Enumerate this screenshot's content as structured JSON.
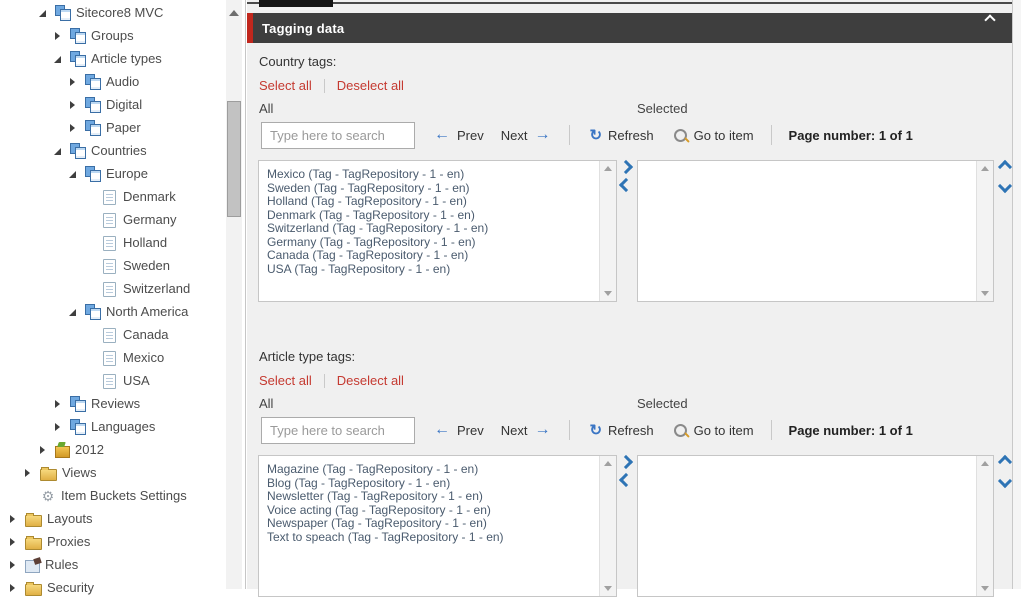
{
  "tree": {
    "items": [
      {
        "label": "Sitecore8 MVC",
        "depth": 2,
        "state": "expanded",
        "icon": "sitecore-node-icon"
      },
      {
        "label": "Groups",
        "depth": 3,
        "state": "collapsed",
        "icon": "sitecore-node-icon"
      },
      {
        "label": "Article types",
        "depth": 3,
        "state": "expanded",
        "icon": "sitecore-node-icon"
      },
      {
        "label": "Audio",
        "depth": 4,
        "state": "collapsed",
        "icon": "sitecore-node-icon"
      },
      {
        "label": "Digital",
        "depth": 4,
        "state": "collapsed",
        "icon": "sitecore-node-icon"
      },
      {
        "label": "Paper",
        "depth": 4,
        "state": "collapsed",
        "icon": "sitecore-node-icon"
      },
      {
        "label": "Countries",
        "depth": 3,
        "state": "expanded",
        "icon": "sitecore-node-icon"
      },
      {
        "label": "Europe",
        "depth": 4,
        "state": "expanded",
        "icon": "sitecore-node-icon"
      },
      {
        "label": "Denmark",
        "depth": 5,
        "state": "none",
        "icon": "document-icon"
      },
      {
        "label": "Germany",
        "depth": 5,
        "state": "none",
        "icon": "document-icon"
      },
      {
        "label": "Holland",
        "depth": 5,
        "state": "none",
        "icon": "document-icon"
      },
      {
        "label": "Sweden",
        "depth": 5,
        "state": "none",
        "icon": "document-icon"
      },
      {
        "label": "Switzerland",
        "depth": 5,
        "state": "none",
        "icon": "document-icon"
      },
      {
        "label": "North America",
        "depth": 4,
        "state": "expanded",
        "icon": "sitecore-node-icon"
      },
      {
        "label": "Canada",
        "depth": 5,
        "state": "none",
        "icon": "document-icon"
      },
      {
        "label": "Mexico",
        "depth": 5,
        "state": "none",
        "icon": "document-icon"
      },
      {
        "label": "USA",
        "depth": 5,
        "state": "none",
        "icon": "document-icon"
      },
      {
        "label": "Reviews",
        "depth": 3,
        "state": "collapsed",
        "icon": "sitecore-node-icon"
      },
      {
        "label": "Languages",
        "depth": 3,
        "state": "collapsed",
        "icon": "sitecore-node-icon"
      },
      {
        "label": "2012",
        "depth": 2,
        "state": "collapsed",
        "icon": "archive-icon"
      },
      {
        "label": "Views",
        "depth": 1,
        "state": "collapsed",
        "icon": "folder-icon"
      },
      {
        "label": "Item Buckets Settings",
        "depth": 1,
        "state": "none",
        "icon": "gear-icon"
      },
      {
        "label": "Layouts",
        "depth": 0,
        "state": "collapsed",
        "icon": "folder-icon"
      },
      {
        "label": "Proxies",
        "depth": 0,
        "state": "collapsed",
        "icon": "folder-icon"
      },
      {
        "label": "Rules",
        "depth": 0,
        "state": "collapsed",
        "icon": "rules-icon"
      },
      {
        "label": "Security",
        "depth": 0,
        "state": "collapsed",
        "icon": "folder-icon"
      }
    ]
  },
  "panel": {
    "title": "Tagging data",
    "collapse_icon": "chevron-up-icon",
    "sections": [
      {
        "id": "country-tags",
        "label": "Country tags:",
        "select_all_label": "Select all",
        "deselect_all_label": "Deselect all",
        "all_label": "All",
        "selected_label": "Selected",
        "search_placeholder": "Type here to search",
        "prev_label": "Prev",
        "next_label": "Next",
        "refresh_label": "Refresh",
        "goto_label": "Go to item",
        "page_label": "Page number: 1 of 1",
        "items": [
          "Mexico (Tag - TagRepository - 1 - en)",
          "Sweden (Tag - TagRepository - 1 - en)",
          "Holland (Tag - TagRepository - 1 - en)",
          "Denmark (Tag - TagRepository - 1 - en)",
          "Switzerland (Tag - TagRepository - 1 - en)",
          "Germany (Tag - TagRepository - 1 - en)",
          "Canada (Tag - TagRepository - 1 - en)",
          "USA (Tag - TagRepository - 1 - en)"
        ],
        "selected_items": []
      },
      {
        "id": "article-type-tags",
        "label": "Article type tags:",
        "select_all_label": "Select all",
        "deselect_all_label": "Deselect all",
        "all_label": "All",
        "selected_label": "Selected",
        "search_placeholder": "Type here to search",
        "prev_label": "Prev",
        "next_label": "Next",
        "refresh_label": "Refresh",
        "goto_label": "Go to item",
        "page_label": "Page number: 1 of 1",
        "items": [
          "Magazine (Tag - TagRepository - 1 - en)",
          "Blog (Tag - TagRepository - 1 - en)",
          "Newsletter (Tag - TagRepository - 1 - en)",
          "Voice acting (Tag - TagRepository - 1 - en)",
          "Newspaper (Tag - TagRepository - 1 - en)",
          "Text to speach (Tag - TagRepository - 1 - en)"
        ],
        "selected_items": []
      }
    ]
  },
  "colors": {
    "accent_red": "#c1271d",
    "link_red": "#c53a31",
    "header_dark": "#3e3e3e",
    "toolbar_blue": "#3a75c4",
    "chevron_blue": "#2e74b5",
    "panel_bg": "#f0f0f0",
    "list_text": "#4a5b6e"
  },
  "glyphs": {
    "prev_arrow": "←",
    "next_arrow": "→",
    "refresh": "↻",
    "gear": "⚙"
  }
}
